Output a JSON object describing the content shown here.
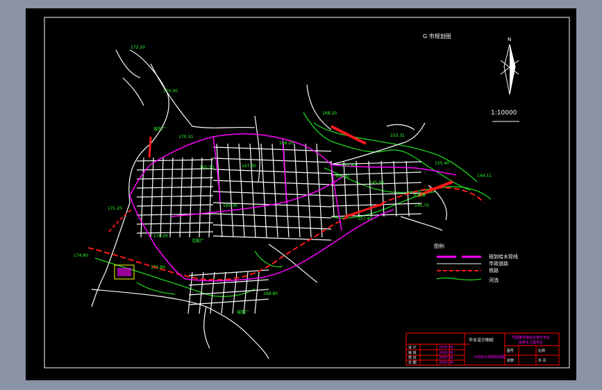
{
  "title": "G 市规划图",
  "north_label": "N",
  "scale_label": "1:10000",
  "elevations": [
    "172.20",
    "170.00",
    "168.20",
    "170.10",
    "168.20",
    "165.30",
    "167.80",
    "153.31",
    "152.40",
    "145.90",
    "155.40",
    "144.11",
    "171.20",
    "165.30",
    "145.70",
    "157.40",
    "170.00",
    "174.80",
    "173.80",
    "168.80"
  ],
  "places": [
    "城东厂",
    "河心水厂",
    "大鱼塘",
    "北配厂",
    "城南厂"
  ],
  "legend": {
    "heading": "图例:",
    "items": [
      "规划给水管线",
      "市政道路",
      "铁路",
      "河流"
    ]
  },
  "title_block": {
    "design_title": "毕业设计图纸",
    "school": "中国某学院给水排水专业",
    "subject": "给排水工程专业",
    "drawing": "G市给水管网规划图",
    "rows": [
      "设 计",
      "审 核",
      "校 对",
      "日 期"
    ],
    "values": [
      "2005.06",
      "2005.06",
      "2005.06",
      "2005.06"
    ],
    "refs": [
      "图号",
      "比例",
      "张数",
      "共 页"
    ]
  },
  "colors": {
    "background": "#000000",
    "border": "#ffffff",
    "road": "#ffffff",
    "pipe": "#ff00ff",
    "rail": "#ff1a1a",
    "river": "#1fd31f",
    "label": "#2fff2f"
  }
}
